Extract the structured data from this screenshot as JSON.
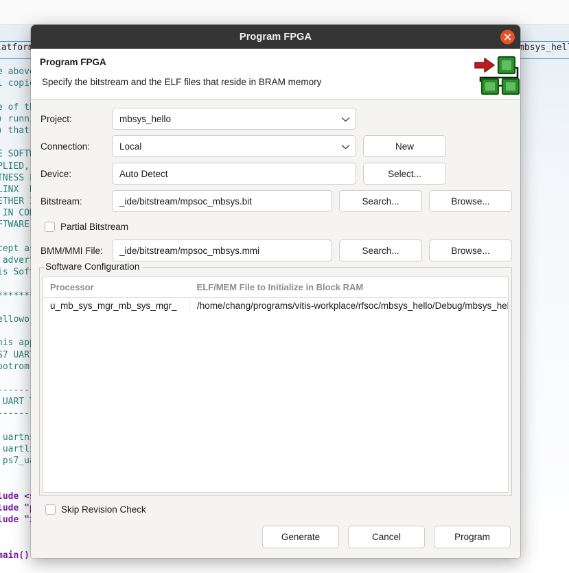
{
  "window": {
    "title": "Program FPGA",
    "close_icon": "close-icon"
  },
  "header": {
    "heading": "Program FPGA",
    "description": "Specify the bitstream and the ELF files that reside in BRAM memory",
    "icon": "fpga-program-icon"
  },
  "form": {
    "project": {
      "label": "Project:",
      "value": "mbsys_hello",
      "chevron_icon": "chevron-down-icon"
    },
    "connection": {
      "label": "Connection:",
      "value": "Local",
      "chevron_icon": "chevron-down-icon",
      "new_button": "New"
    },
    "device": {
      "label": "Device:",
      "value": "Auto Detect",
      "select_button": "Select..."
    },
    "bitstream": {
      "label": "Bitstream:",
      "value": "_ide/bitstream/mpsoc_mbsys.bit",
      "search_button": "Search...",
      "browse_button": "Browse..."
    },
    "partial_bitstream": {
      "label": "Partial Bitstream",
      "checked": false
    },
    "bmm_mmi": {
      "label": "BMM/MMI File:",
      "value": "_ide/bitstream/mpsoc_mbsys.mmi",
      "search_button": "Search...",
      "browse_button": "Browse..."
    }
  },
  "software_configuration": {
    "group_title": "Software Configuration",
    "columns": [
      "Processor",
      "ELF/MEM File to Initialize in Block RAM"
    ],
    "rows": [
      {
        "processor": "u_mb_sys_mgr_mb_sys_mgr_",
        "elf_file": "/home/chang/programs/vitis-workplace/rfsoc/mbsys_hello/Debug/mbsys_hello.elf"
      }
    ]
  },
  "footer": {
    "skip_revision_check": {
      "label": "Skip Revision Check",
      "checked": false
    },
    "generate_button": "Generate",
    "cancel_button": "Cancel",
    "program_button": "Program"
  },
  "background": {
    "tab_left": "latform",
    "tab_right": "mbsys_hello",
    "code_lines": [
      "e above",
      "l copie",
      "",
      "e of th",
      ") runni",
      ") that ",
      "",
      "E SOFTW",
      "PLIED, ",
      "TNESS F",
      "LINX  B",
      "ETHER I",
      " IN CON",
      "FTWARE ",
      "",
      "cept as",
      " advert",
      "is Soft",
      "",
      "*******",
      "",
      "ellowor",
      "",
      "his app",
      "S7 UART",
      "ootrom,",
      "",
      "-------",
      " UART T",
      "-------",
      "",
      " uartns",
      " uartli",
      " ps7_ua",
      "",
      "",
      "lude <s",
      "lude \"p",
      "lude \"x",
      "",
      "",
      "main() "
    ]
  },
  "colors": {
    "titlebar": "#353535",
    "close": "#e8521f",
    "dialog_bg": "#f5f4f2",
    "accent_green": "#2f8f2f",
    "accent_red": "#b81e1e"
  }
}
